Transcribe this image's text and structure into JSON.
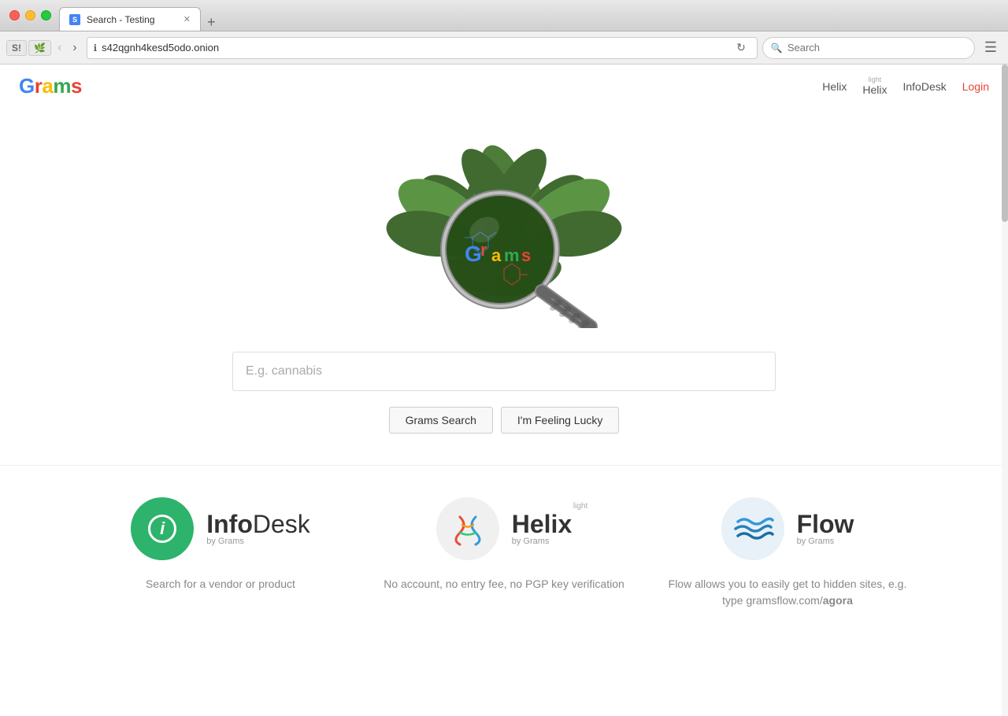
{
  "window": {
    "tab_title": "Search - Testing",
    "url": "s42qgnh4kesd5odo.onion",
    "search_placeholder": "Search",
    "traffic_lights": [
      "red",
      "yellow",
      "green"
    ]
  },
  "site": {
    "logo": "Grams",
    "logo_letters": [
      "G",
      "r",
      "a",
      "m",
      "s"
    ],
    "logo_colors": [
      "#4285f4",
      "#ea4335",
      "#fbbc04",
      "#34a853",
      "#ea4335"
    ]
  },
  "nav": {
    "helix_label": "Helix",
    "helix_light_label": "Helix",
    "helix_light_sub": "light",
    "infodesk_label": "InfoDesk",
    "login_label": "Login"
  },
  "search": {
    "input_placeholder": "E.g. cannabis",
    "button_search": "Grams Search",
    "button_lucky": "I'm Feeling Lucky"
  },
  "services": [
    {
      "id": "infodesk",
      "name_part1": "Info",
      "name_part2": "Desk",
      "by_grams": "by Grams",
      "description": "Search for a vendor or product",
      "icon_type": "infodesk"
    },
    {
      "id": "helix",
      "name": "Helix",
      "name_light": "light",
      "by_grams": "by Grams",
      "description": "No account, no entry fee, no PGP key verification",
      "icon_type": "helix"
    },
    {
      "id": "flow",
      "name": "Flow",
      "by_grams": "by Grams",
      "description": "Flow allows you to easily get to hidden sites, e.g. type gramsflow.com/agora",
      "description_bold": "agora",
      "icon_type": "flow"
    }
  ]
}
